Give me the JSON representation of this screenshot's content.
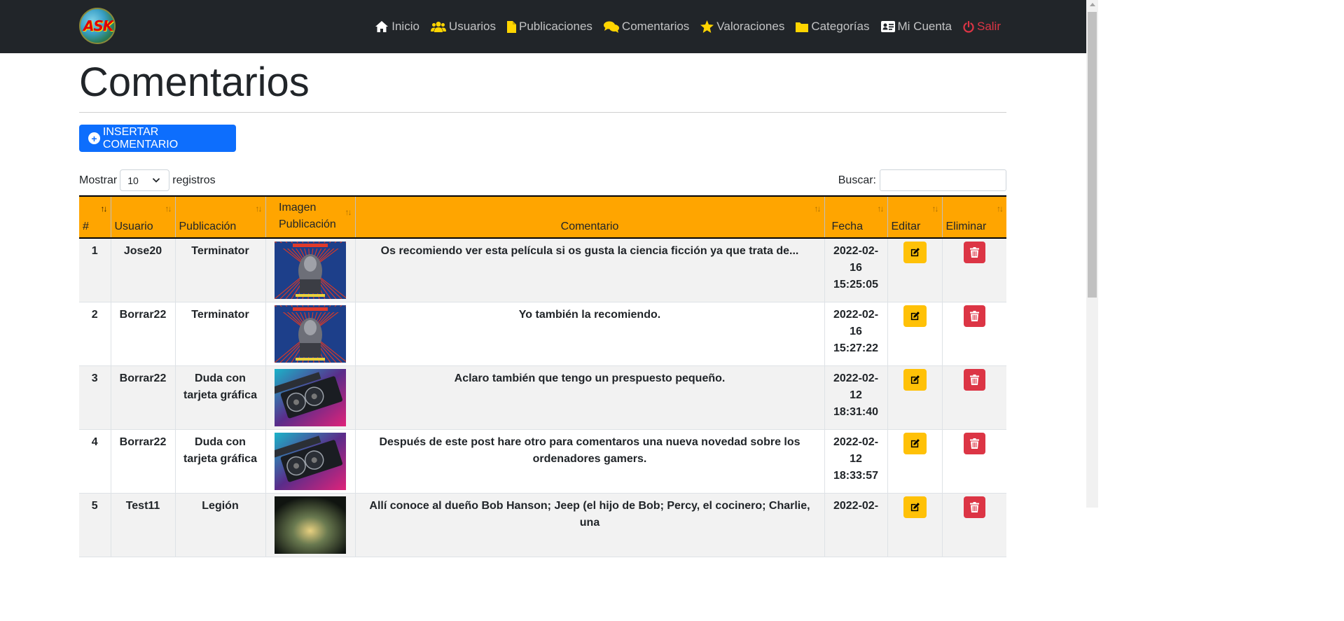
{
  "navbar": {
    "logo_text": "ASK",
    "items": [
      {
        "label": "Inicio",
        "icon": "home-icon"
      },
      {
        "label": "Usuarios",
        "icon": "users-icon"
      },
      {
        "label": "Publicaciones",
        "icon": "file-icon"
      },
      {
        "label": "Comentarios",
        "icon": "comments-icon"
      },
      {
        "label": "Valoraciones",
        "icon": "star-icon"
      },
      {
        "label": "Categorías",
        "icon": "folder-icon"
      },
      {
        "label": "Mi Cuenta",
        "icon": "id-card-icon"
      },
      {
        "label": "Salir",
        "icon": "power-icon"
      }
    ],
    "icon_color": "#ffd500",
    "logout_color": "#dc3545"
  },
  "page": {
    "title": "Comentarios",
    "insert_button": "INSERTAR COMENTARIO",
    "show_label": "Mostrar",
    "page_size": "10",
    "records_label": "registros",
    "search_label": "Buscar:",
    "search_value": ""
  },
  "table": {
    "header_color": "#ffa500",
    "headers": [
      "#",
      "Usuario",
      "Publicación",
      "Imagen Publicación",
      "Comentario",
      "Fecha",
      "Editar",
      "Eliminar"
    ],
    "rows": [
      {
        "id": "1",
        "user": "Jose20",
        "post": "Terminator",
        "image": "terminator-poster",
        "comment": "Os recomiendo ver esta película si os gusta la ciencia ficción ya que trata de...",
        "date": "2022-02-16 15:25:05"
      },
      {
        "id": "2",
        "user": "Borrar22",
        "post": "Terminator",
        "image": "terminator-poster",
        "comment": "Yo también la recomiendo.",
        "date": "2022-02-16 15:27:22"
      },
      {
        "id": "3",
        "user": "Borrar22",
        "post": "Duda con tarjeta gráfica",
        "image": "graphics-card",
        "comment": "Aclaro también que tengo un prespuesto pequeño.",
        "date": "2022-02-12 18:31:40"
      },
      {
        "id": "4",
        "user": "Borrar22",
        "post": "Duda con tarjeta gráfica",
        "image": "graphics-card",
        "comment": "Después de este post hare otro para comentaros una nueva novedad sobre los ordenadores gamers.",
        "date": "2022-02-12 18:33:57"
      },
      {
        "id": "5",
        "user": "Test11",
        "post": "Legión",
        "image": "legion-poster",
        "comment": "Allí conoce al dueño Bob Hanson; Jeep (el hijo de Bob; Percy, el cocinero; Charlie, una",
        "date": "2022-02-"
      }
    ]
  }
}
